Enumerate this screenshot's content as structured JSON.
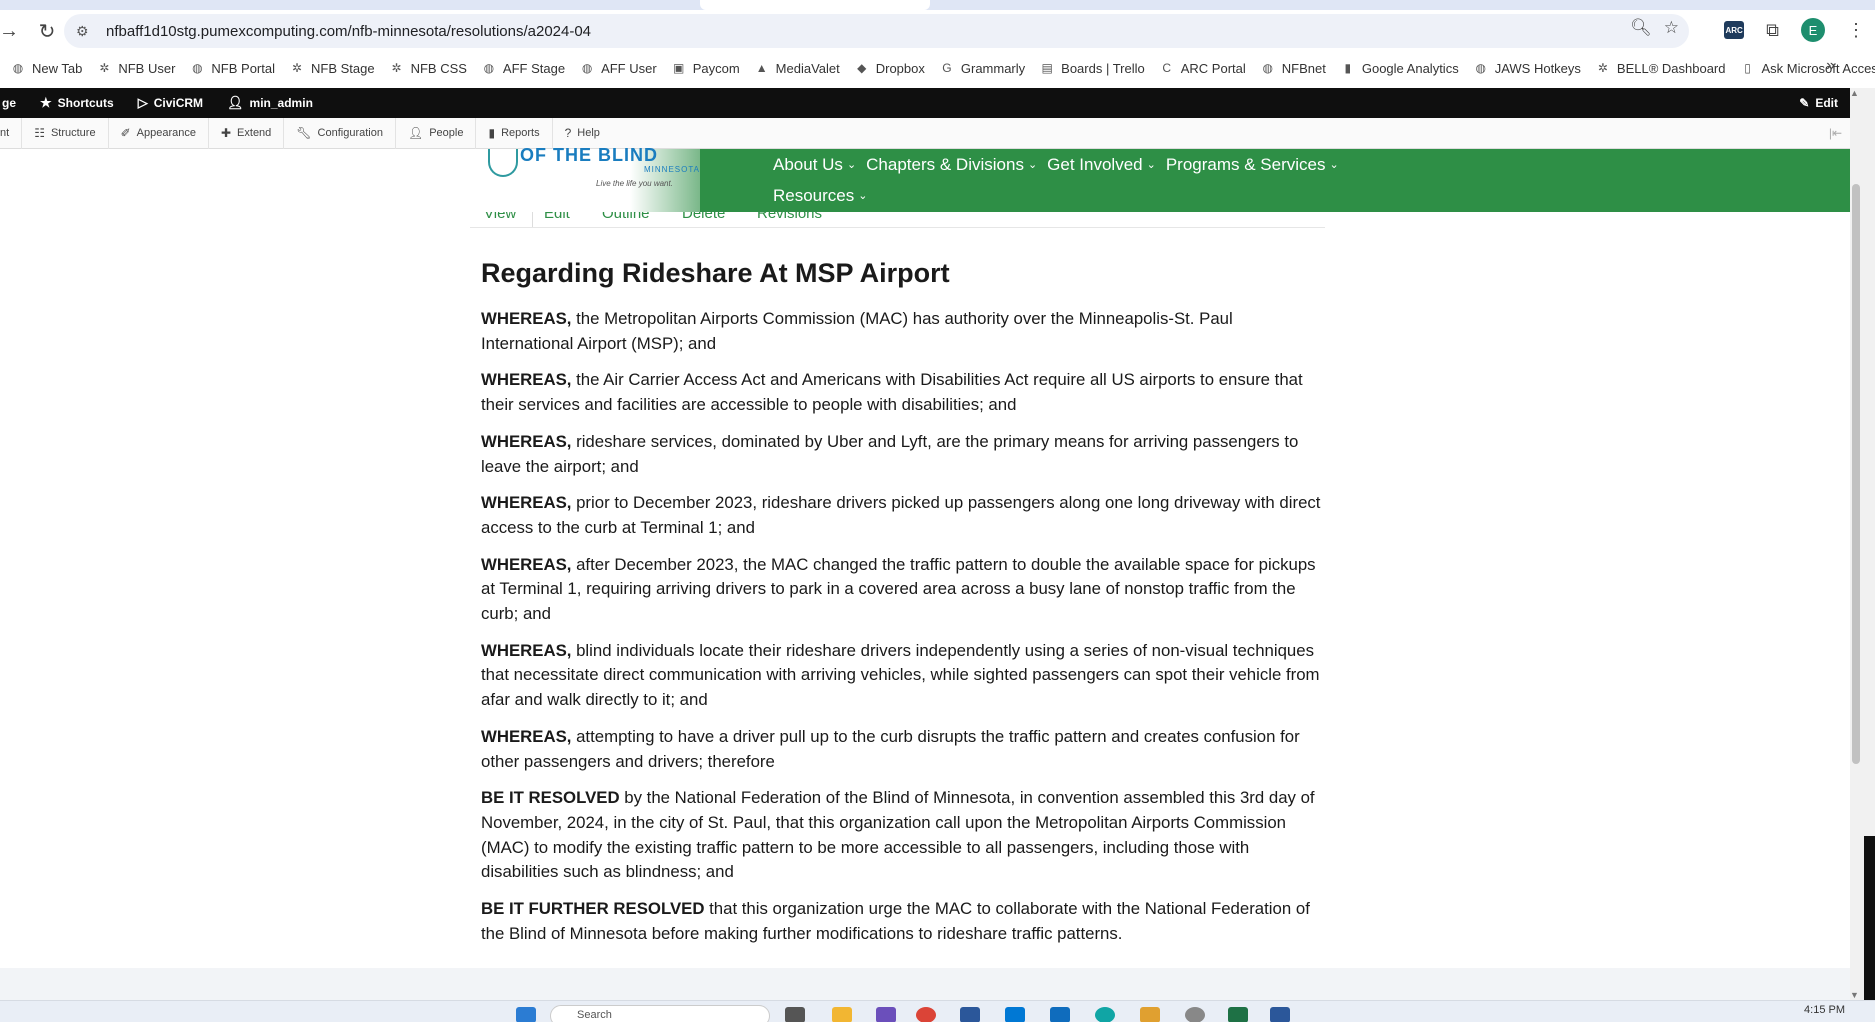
{
  "browser": {
    "url": "nfbaff1d10stg.pumexcomputing.com/nfb-minnesota/resolutions/a2024-04",
    "profile_initial": "E",
    "ext_label": "ARC"
  },
  "bookmarks": [
    {
      "label": "New Tab",
      "icon": "globe-icon"
    },
    {
      "label": "NFB User",
      "icon": "nfb-star-icon"
    },
    {
      "label": "NFB Portal",
      "icon": "globe-icon"
    },
    {
      "label": "NFB Stage",
      "icon": "nfb-star-icon"
    },
    {
      "label": "NFB CSS",
      "icon": "nfb-star-icon"
    },
    {
      "label": "AFF Stage",
      "icon": "globe-icon"
    },
    {
      "label": "AFF User",
      "icon": "globe-icon"
    },
    {
      "label": "Paycom",
      "icon": "paycom-icon"
    },
    {
      "label": "MediaValet",
      "icon": "mediavalet-icon"
    },
    {
      "label": "Dropbox",
      "icon": "dropbox-icon"
    },
    {
      "label": "Grammarly",
      "icon": "grammarly-icon"
    },
    {
      "label": "Boards | Trello",
      "icon": "trello-icon"
    },
    {
      "label": "ARC Portal",
      "icon": "arc-icon"
    },
    {
      "label": "NFBnet",
      "icon": "globe-icon"
    },
    {
      "label": "Google Analytics",
      "icon": "analytics-icon"
    },
    {
      "label": "JAWS Hotkeys",
      "icon": "globe-icon"
    },
    {
      "label": "BELL® Dashboard",
      "icon": "nfb-star-icon"
    },
    {
      "label": "Ask Microsoft Acces...",
      "icon": "document-icon"
    }
  ],
  "admin_bar": {
    "manage_partial": "ge",
    "shortcuts": "Shortcuts",
    "civicrm": "CiviCRM",
    "user": "min_admin",
    "edit": "Edit"
  },
  "admin_tray": {
    "partial": "nt",
    "items": [
      "Structure",
      "Appearance",
      "Extend",
      "Configuration",
      "People",
      "Reports",
      "Help"
    ]
  },
  "site": {
    "logo_text": "OF THE BLIND",
    "logo_sub": "MINNESOTA",
    "logo_tag": "Live the life you want.",
    "nav_row1": [
      "About Us",
      "Chapters & Divisions",
      "Get Involved",
      "Programs & Services"
    ],
    "nav_row2": [
      "Resources"
    ],
    "local_tabs": [
      "View",
      "Edit",
      "Outline",
      "Delete",
      "Revisions"
    ]
  },
  "article": {
    "title": "Regarding Rideshare At MSP Airport",
    "paragraphs": [
      {
        "lead": "WHEREAS,",
        "text": " the Metropolitan Airports Commission (MAC) has authority over the Minneapolis-St. Paul International Airport (MSP); and"
      },
      {
        "lead": "WHEREAS,",
        "text": " the Air Carrier Access Act and Americans with Disabilities Act require all US airports to ensure that their services and facilities are accessible to people with disabilities; and"
      },
      {
        "lead": "WHEREAS,",
        "text": " rideshare services, dominated by Uber and Lyft, are the primary means for arriving passengers to leave the airport; and"
      },
      {
        "lead": "WHEREAS,",
        "text": " prior to December 2023, rideshare drivers picked up passengers along one long driveway with direct access to the curb at Terminal 1; and"
      },
      {
        "lead": "WHEREAS,",
        "text": " after December 2023, the MAC changed the traffic pattern to double the available space for pickups at Terminal 1, requiring arriving drivers to park in a covered area across a busy lane of nonstop traffic from the curb; and"
      },
      {
        "lead": "WHEREAS,",
        "text": " blind individuals locate their rideshare drivers independently using a series of non-visual techniques that necessitate direct communication with arriving vehicles, while sighted passengers can spot their vehicle from afar and walk directly to it; and"
      },
      {
        "lead": "WHEREAS,",
        "text": " attempting to have a driver pull up to the curb disrupts the traffic pattern and creates confusion for other passengers and drivers; therefore"
      },
      {
        "lead": "BE IT RESOLVED",
        "text": " by the National Federation of the Blind of Minnesota, in convention assembled this 3rd day of November, 2024, in the city of St. Paul, that this organization call upon the Metropolitan Airports Commission (MAC) to modify the existing traffic pattern to be more accessible to all passengers, including those with disabilities such as blindness; and"
      },
      {
        "lead": "BE IT FURTHER RESOLVED",
        "text": " that this organization urge the MAC to collaborate with the National Federation of the Blind of Minnesota before making further modifications to rideshare traffic patterns."
      }
    ]
  },
  "taskbar": {
    "search_placeholder": "Search",
    "clock": "4:15 PM"
  }
}
